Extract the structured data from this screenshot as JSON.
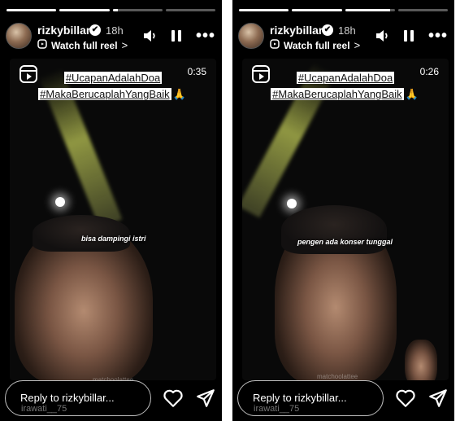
{
  "stories": [
    {
      "username": "rizkybillar",
      "verified_badge": "✔",
      "time_ago": "18h",
      "watch_label": "Watch full reel",
      "watch_chevron": ">",
      "more_label": "•••",
      "duration": "0:35",
      "hashtag_1": "#UcapanAdalahDoa",
      "hashtag_2": "#MakaBerucaplahYangBaik",
      "hashtag_emoji": "🙏",
      "caption": "bisa dampingi istri",
      "watermark": "matchoolattee",
      "reply_placeholder": "Reply to rizkybillar...",
      "reply_hint": "irawati__75",
      "progress": [
        1,
        1,
        0.1,
        0
      ]
    },
    {
      "username": "rizkybillar",
      "verified_badge": "✔",
      "time_ago": "18h",
      "watch_label": "Watch full reel",
      "watch_chevron": ">",
      "more_label": "•••",
      "duration": "0:26",
      "hashtag_1": "#UcapanAdalahDoa",
      "hashtag_2": "#MakaBerucaplahYangBaik",
      "hashtag_emoji": "🙏",
      "caption": "pengen ada konser tunggal",
      "watermark": "matchoolattee",
      "reply_placeholder": "Reply to rizkybillar...",
      "reply_hint": "irawati__75",
      "progress": [
        1,
        1,
        0.9,
        0
      ]
    }
  ],
  "icons": {
    "audio": "speaker-icon",
    "pause": "pause-icon",
    "more": "more-options-icon",
    "reel": "reel-icon",
    "like": "heart-icon",
    "share": "send-icon"
  },
  "colors": {
    "background": "#000000",
    "text": "#ffffff",
    "hashtag_highlight": "#ffffff"
  }
}
